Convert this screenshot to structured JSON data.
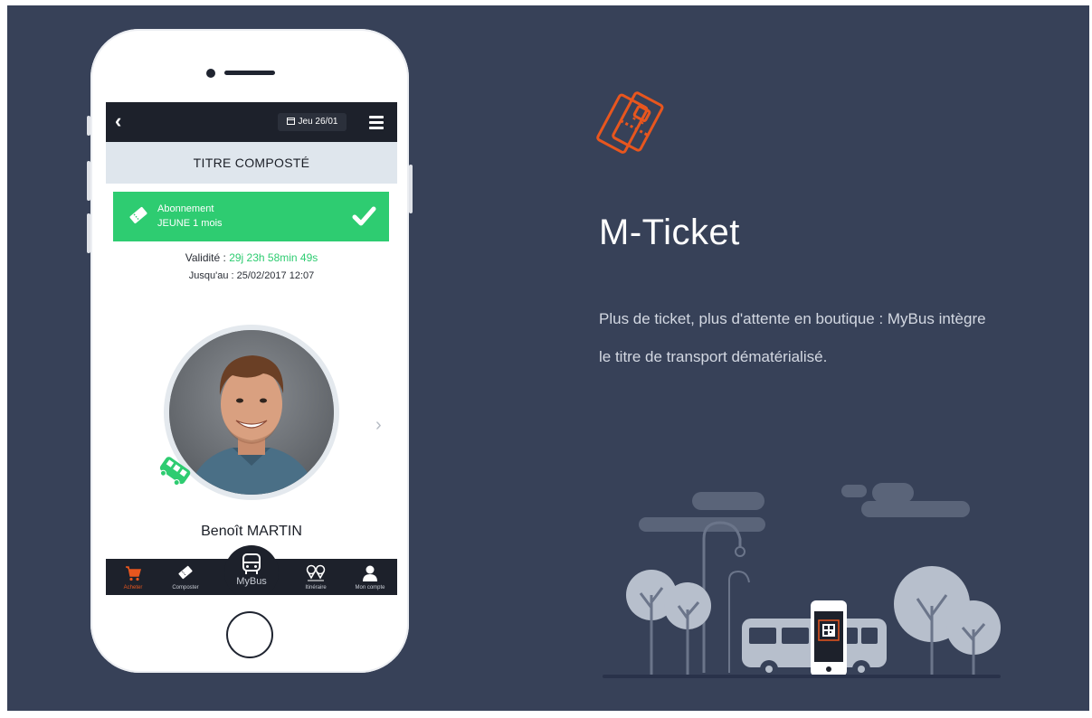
{
  "phone": {
    "topbar": {
      "back_icon": "chevron-left-icon",
      "date": "Jeu 26/01",
      "menu_icon": "hamburger-menu-icon"
    },
    "title": "TITRE COMPOSTÉ",
    "ticket": {
      "type": "Abonnement",
      "name": "JEUNE 1 mois",
      "status_icon": "check-icon"
    },
    "validity": {
      "label": "Validité :",
      "value": "29j 23h 58min 49s",
      "until": "Jusqu'au : 25/02/2017 12:07"
    },
    "user": {
      "name": "Benoît MARTIN"
    },
    "tabs": [
      {
        "label": "Acheter",
        "icon": "cart-icon",
        "active": true
      },
      {
        "label": "Composter",
        "icon": "ticket-icon",
        "active": false
      },
      {
        "label": "MyBus",
        "icon": "bus-icon",
        "active": false
      },
      {
        "label": "Itinéraire",
        "icon": "route-pins-icon",
        "active": false
      },
      {
        "label": "Mon compte",
        "icon": "user-icon",
        "active": false
      }
    ]
  },
  "feature": {
    "icon": "ticket-icon",
    "title": "M-Ticket",
    "description": "Plus de ticket, plus d'attente en boutique : MyBus intègre le titre de transport dématérialisé."
  },
  "colors": {
    "background": "#374158",
    "accent_green": "#2ecc71",
    "accent_orange": "#e8561e",
    "phone_dark": "#1d212b"
  }
}
